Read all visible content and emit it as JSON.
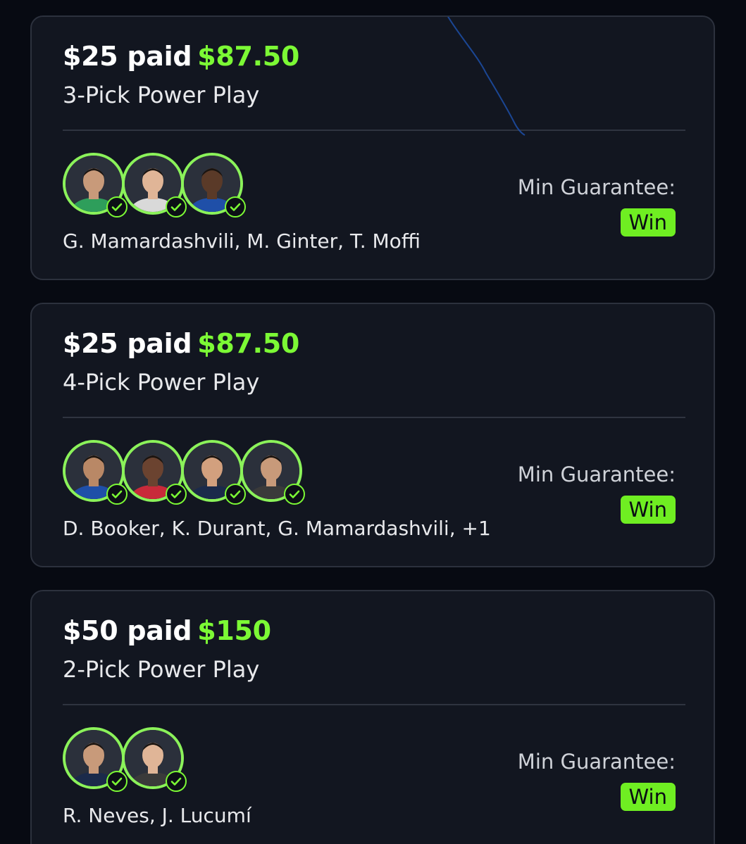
{
  "colors": {
    "background": "#070a12",
    "card": "#121620",
    "card_border": "#2c313d",
    "accent_green": "#7cf935",
    "badge_green": "#6fee22",
    "avatar_ring": "#8bf25a"
  },
  "entries": [
    {
      "paid_text": "$25 paid",
      "payout": "$87.50",
      "play_type": "3-Pick Power Play",
      "players": "G. Mamardashvili, M. Ginter, T. Moffi",
      "avatar_count": 3,
      "min_guarantee_label": "Min Guarantee:",
      "result": "Win"
    },
    {
      "paid_text": "$25 paid",
      "payout": "$87.50",
      "play_type": "4-Pick Power Play",
      "players": "D. Booker, K. Durant, G. Mamardashvili, +1",
      "avatar_count": 4,
      "min_guarantee_label": "Min Guarantee:",
      "result": "Win"
    },
    {
      "paid_text": "$50 paid",
      "payout": "$150",
      "play_type": "2-Pick Power Play",
      "players": "R. Neves, J. Lucumí",
      "avatar_count": 2,
      "min_guarantee_label": "Min Guarantee:",
      "result": "Win"
    }
  ],
  "avatar_icons": [
    [
      "player-photo-icon",
      "player-photo-icon",
      "player-photo-icon"
    ],
    [
      "player-photo-icon",
      "player-photo-icon",
      "player-photo-icon",
      "player-photo-icon"
    ],
    [
      "player-photo-icon",
      "player-photo-icon"
    ]
  ],
  "status_icon": "check-circle-icon"
}
